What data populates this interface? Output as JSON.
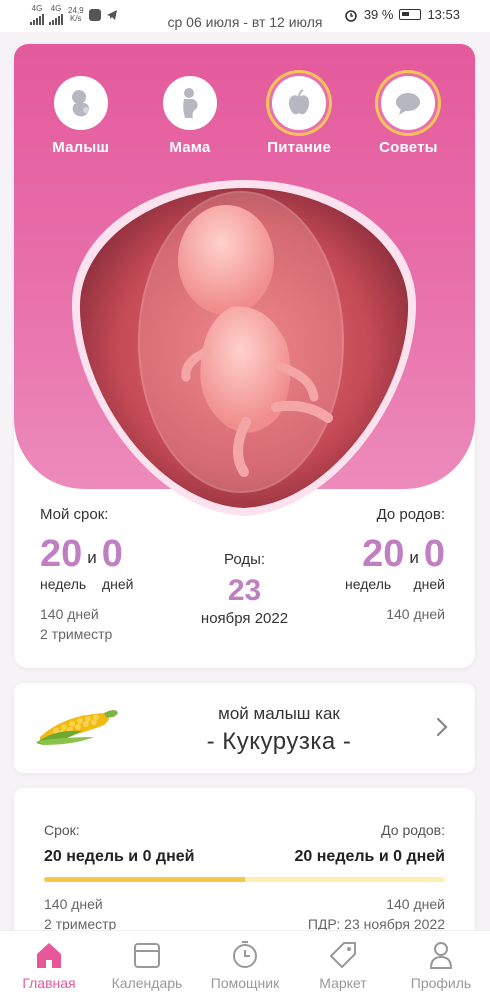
{
  "status_bar": {
    "net_speed_value": "24,9",
    "net_speed_unit": "K/s",
    "date_range": "ср 06 июля - вт 12 июля",
    "battery": "39 %",
    "time": "13:53",
    "signal_1": "4G",
    "signal_2": "4G"
  },
  "tabs": [
    {
      "label": "Малыш",
      "icon": "baby-icon"
    },
    {
      "label": "Мама",
      "icon": "mother-icon"
    },
    {
      "label": "Питание",
      "icon": "apple-icon"
    },
    {
      "label": "Советы",
      "icon": "chat-bubble-icon"
    }
  ],
  "term": {
    "label": "Мой срок:",
    "weeks": "20",
    "and": "и",
    "days": "0",
    "weeks_unit": "недель",
    "days_unit": "дней",
    "total_days": "140 дней",
    "trimester": "2 триместр"
  },
  "due": {
    "label": "Роды:",
    "day": "23",
    "month_year": "ноября 2022"
  },
  "until_birth": {
    "label": "До родов:",
    "weeks": "20",
    "and": "и",
    "days": "0",
    "weeks_unit": "недель",
    "days_unit": "дней",
    "total_days": "140 дней"
  },
  "size_card": {
    "subtitle": "мой малыш как",
    "fruit": "- Кукурузка -",
    "icon": "corn-icon"
  },
  "progress_card": {
    "left_label": "Срок:",
    "right_label": "До родов:",
    "left_value": "20 недель и 0 дней",
    "right_value": "20 недель и 0 дней",
    "progress_fraction": 0.5,
    "left_days": "140 дней",
    "left_trimester": "2 триместр",
    "right_days": "140 дней",
    "right_pdr": "ПДР: 23 ноября 2022"
  },
  "nav": [
    {
      "label": "Главная",
      "icon": "home-icon",
      "active": true
    },
    {
      "label": "Календарь",
      "icon": "calendar-icon",
      "active": false
    },
    {
      "label": "Помощник",
      "icon": "timer-icon",
      "active": false
    },
    {
      "label": "Маркет",
      "icon": "tag-icon",
      "active": false
    },
    {
      "label": "Профиль",
      "icon": "profile-icon",
      "active": false
    }
  ],
  "colors": {
    "accent": "#e9579b",
    "pink_gradient_top": "#e45a9c",
    "pink_gradient_bottom": "#ec8bbb",
    "number_purple": "#c07fc0",
    "progress_yellow": "#f2c94c"
  }
}
